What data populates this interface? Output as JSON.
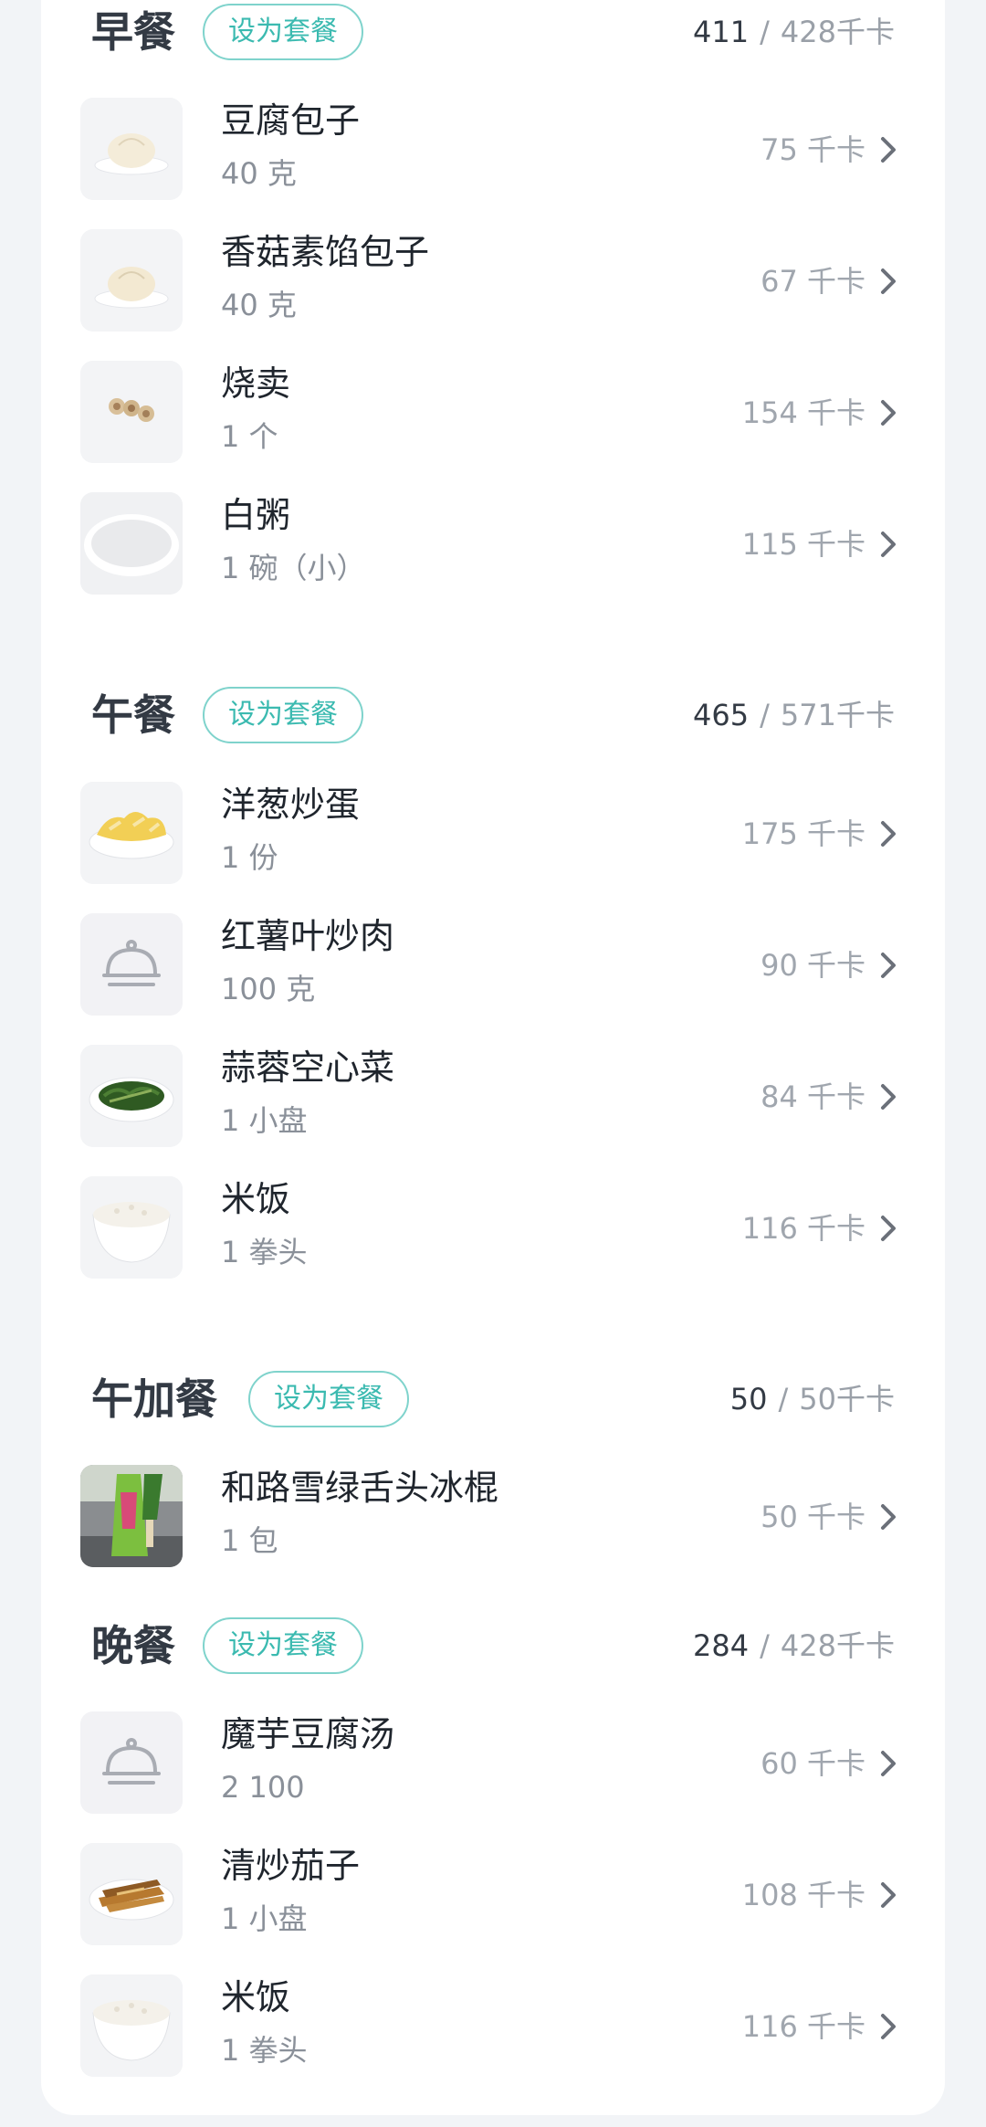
{
  "meals": [
    {
      "title": "早餐",
      "button": "设为套餐",
      "eaten": "411",
      "sep": "/",
      "target": "428千卡",
      "foods": [
        {
          "name": "豆腐包子",
          "amount": "40 克",
          "kcal": "75 千卡",
          "icon": "bun-icon"
        },
        {
          "name": "香菇素馅包子",
          "amount": "40 克",
          "kcal": "67 千卡",
          "icon": "bun-icon"
        },
        {
          "name": "烧卖",
          "amount": "1 个",
          "kcal": "154 千卡",
          "icon": "shumai-icon"
        },
        {
          "name": "白粥",
          "amount": "1 碗（小）",
          "kcal": "115 千卡",
          "icon": "porridge-icon"
        }
      ]
    },
    {
      "title": "午餐",
      "button": "设为套餐",
      "eaten": "465",
      "sep": "/",
      "target": "571千卡",
      "foods": [
        {
          "name": "洋葱炒蛋",
          "amount": "1 份",
          "kcal": "175 千卡",
          "icon": "egg-dish-icon"
        },
        {
          "name": "红薯叶炒肉",
          "amount": "100 克",
          "kcal": "90 千卡",
          "icon": "cloche-icon"
        },
        {
          "name": "蒜蓉空心菜",
          "amount": "1 小盘",
          "kcal": "84 千卡",
          "icon": "greens-icon"
        },
        {
          "name": "米饭",
          "amount": "1 拳头",
          "kcal": "116 千卡",
          "icon": "rice-icon"
        }
      ]
    },
    {
      "title": "午加餐",
      "button": "设为套餐",
      "eaten": "50",
      "sep": "/",
      "target": "50千卡",
      "foods": [
        {
          "name": "和路雪绿舌头冰棍",
          "amount": "1 包",
          "kcal": "50 千卡",
          "icon": "ice-pop-icon"
        }
      ]
    },
    {
      "title": "晚餐",
      "button": "设为套餐",
      "eaten": "284",
      "sep": "/",
      "target": "428千卡",
      "foods": [
        {
          "name": "魔芋豆腐汤",
          "amount": "2 100",
          "kcal": "60 千卡",
          "icon": "cloche-icon"
        },
        {
          "name": "清炒茄子",
          "amount": "1 小盘",
          "kcal": "108 千卡",
          "icon": "eggplant-icon"
        },
        {
          "name": "米饭",
          "amount": "1 拳头",
          "kcal": "116 千卡",
          "icon": "rice-icon"
        }
      ]
    }
  ],
  "colors": {
    "accent": "#3bbab0",
    "accent_border": "#7fd3cc",
    "title": "#333a44",
    "text": "#1f252d",
    "muted": "#8a9099"
  }
}
